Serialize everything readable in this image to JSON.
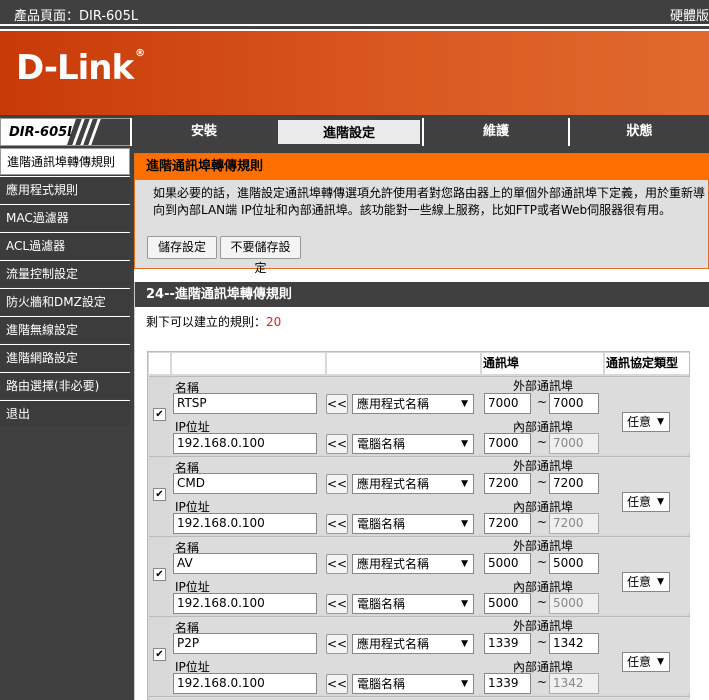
{
  "topbar": {
    "product": "產品頁面：DIR-605L",
    "hw": "硬體版"
  },
  "logo": {
    "text": "D-Link",
    "reg": "®"
  },
  "model": "DIR-605L",
  "tabs": [
    "安裝",
    "進階設定",
    "維護",
    "狀態"
  ],
  "sidebar": [
    "進階通訊埠轉傳規則",
    "應用程式規則",
    "MAC過濾器",
    "ACL過濾器",
    "流量控制設定",
    "防火牆和DMZ設定",
    "進階無線設定",
    "進階網路設定",
    "路由選擇(非必要)",
    "退出"
  ],
  "section1": {
    "title": "進階通訊埠轉傳規則",
    "desc": "如果必要的話，進階設定通訊埠轉傳選項允許使用者對您路由器上的單個外部通訊埠下定義，用於重新導向到內部LAN端 IP位址和內部通訊埠。該功能對一些線上服務，比如FTP或者Web伺服器很有用。",
    "save": "儲存設定",
    "nosave": "不要儲存設定"
  },
  "section2": {
    "title": "24--進階通訊埠轉傳規則",
    "remain_label": "剩下可以建立的規則：",
    "remain_num": "20"
  },
  "table": {
    "h_port": "通訊埠",
    "h_proto": "通訊協定類型",
    "name_label": "名稱",
    "ip_label": "IP位址",
    "ext_label": "外部通訊埠",
    "int_label": "內部通訊埠",
    "copy_btn": "<<",
    "app_sel": "應用程式名稱",
    "pc_sel": "電腦名稱",
    "tilde": "~",
    "rows": [
      {
        "name": "RTSP",
        "ip": "192.168.0.100",
        "ext_start": "7000",
        "ext_end": "7000",
        "int_start": "7000",
        "int_end": "7000",
        "proto": "任意",
        "checked": "✔"
      },
      {
        "name": "CMD",
        "ip": "192.168.0.100",
        "ext_start": "7200",
        "ext_end": "7200",
        "int_start": "7200",
        "int_end": "7200",
        "proto": "任意",
        "checked": "✔"
      },
      {
        "name": "AV",
        "ip": "192.168.0.100",
        "ext_start": "5000",
        "ext_end": "5000",
        "int_start": "5000",
        "int_end": "5000",
        "proto": "任意",
        "checked": "✔"
      },
      {
        "name": "P2P",
        "ip": "192.168.0.100",
        "ext_start": "1339",
        "ext_end": "1342",
        "int_start": "1339",
        "int_end": "1342",
        "proto": "任意",
        "checked": "✔"
      }
    ],
    "next_name_label": "名稱",
    "next_ext_label": "外部通訊埠"
  }
}
